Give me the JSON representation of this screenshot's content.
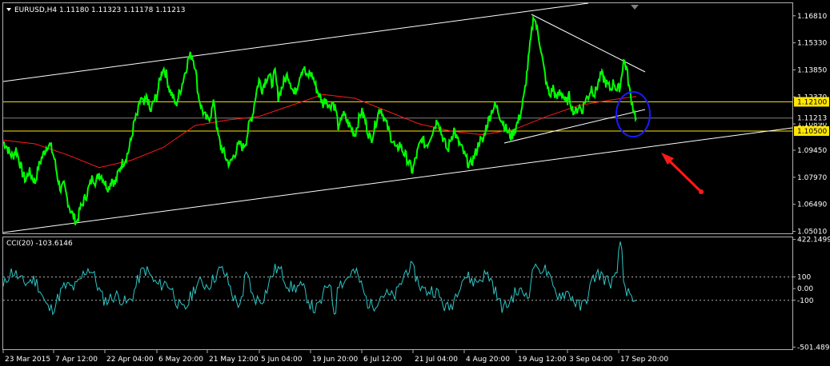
{
  "chart_data": [
    {
      "type": "line",
      "header": "EURUSD,H4  1.11180 1.11323 1.11178 1.11213",
      "y_ticks": [
        1.1681,
        1.1533,
        1.1385,
        1.1237,
        1.1089,
        1.0945,
        1.0797,
        1.0649,
        1.0501
      ],
      "y_tick_labels": [
        "1.16810",
        "1.15330",
        "1.13850",
        "1.12370",
        "1.10890",
        "1.09450",
        "1.07970",
        "1.06490",
        "1.05010"
      ],
      "ylim": [
        1.049,
        1.175
      ],
      "x_tick_labels": [
        "23 Mar 2015",
        "7 Apr 12:00",
        "22 Apr 04:00",
        "6 May 20:00",
        "21 May 12:00",
        "5 Jun 04:00",
        "19 Jun 20:00",
        "6 Jul 12:00",
        "21 Jul 04:00",
        "4 Aug 20:00",
        "19 Aug 12:00",
        "3 Sep 04:00",
        "17 Sep 20:00"
      ],
      "price_close_series": [
        [
          0,
          1.099
        ],
        [
          4,
          1.097
        ],
        [
          8,
          1.093
        ],
        [
          12,
          1.091
        ],
        [
          16,
          1.095
        ],
        [
          20,
          1.089
        ],
        [
          24,
          1.082
        ],
        [
          28,
          1.078
        ],
        [
          32,
          1.083
        ],
        [
          36,
          1.08
        ],
        [
          40,
          1.077
        ],
        [
          44,
          1.085
        ],
        [
          48,
          1.09
        ],
        [
          52,
          1.094
        ],
        [
          56,
          1.098
        ],
        [
          60,
          1.096
        ],
        [
          64,
          1.09
        ],
        [
          68,
          1.08
        ],
        [
          72,
          1.073
        ],
        [
          76,
          1.075
        ],
        [
          80,
          1.068
        ],
        [
          84,
          1.062
        ],
        [
          88,
          1.058
        ],
        [
          92,
          1.055
        ],
        [
          96,
          1.062
        ],
        [
          100,
          1.066
        ],
        [
          104,
          1.07
        ],
        [
          108,
          1.075
        ],
        [
          112,
          1.08
        ],
        [
          116,
          1.077
        ],
        [
          120,
          1.082
        ],
        [
          124,
          1.08
        ],
        [
          128,
          1.076
        ],
        [
          132,
          1.074
        ],
        [
          136,
          1.079
        ],
        [
          140,
          1.076
        ],
        [
          144,
          1.082
        ],
        [
          148,
          1.087
        ],
        [
          152,
          1.089
        ],
        [
          156,
          1.093
        ],
        [
          160,
          1.1
        ],
        [
          164,
          1.11
        ],
        [
          168,
          1.114
        ],
        [
          172,
          1.123
        ],
        [
          176,
          1.119
        ],
        [
          180,
          1.124
        ],
        [
          184,
          1.115
        ],
        [
          188,
          1.121
        ],
        [
          192,
          1.124
        ],
        [
          196,
          1.133
        ],
        [
          200,
          1.14
        ],
        [
          204,
          1.136
        ],
        [
          208,
          1.128
        ],
        [
          212,
          1.124
        ],
        [
          216,
          1.119
        ],
        [
          220,
          1.125
        ],
        [
          224,
          1.131
        ],
        [
          228,
          1.138
        ],
        [
          232,
          1.145
        ],
        [
          236,
          1.147
        ],
        [
          240,
          1.141
        ],
        [
          244,
          1.125
        ],
        [
          248,
          1.118
        ],
        [
          252,
          1.113
        ],
        [
          256,
          1.111
        ],
        [
          260,
          1.115
        ],
        [
          264,
          1.121
        ],
        [
          268,
          1.104
        ],
        [
          272,
          1.097
        ],
        [
          276,
          1.093
        ],
        [
          280,
          1.089
        ],
        [
          284,
          1.087
        ],
        [
          288,
          1.091
        ],
        [
          292,
          1.095
        ],
        [
          296,
          1.098
        ],
        [
          300,
          1.096
        ],
        [
          304,
          1.1
        ],
        [
          308,
          1.109
        ],
        [
          312,
          1.114
        ],
        [
          316,
          1.125
        ],
        [
          320,
          1.133
        ],
        [
          324,
          1.128
        ],
        [
          328,
          1.133
        ],
        [
          332,
          1.136
        ],
        [
          336,
          1.131
        ],
        [
          340,
          1.137
        ],
        [
          344,
          1.124
        ],
        [
          348,
          1.128
        ],
        [
          352,
          1.133
        ],
        [
          356,
          1.136
        ],
        [
          360,
          1.131
        ],
        [
          364,
          1.125
        ],
        [
          368,
          1.13
        ],
        [
          372,
          1.137
        ],
        [
          376,
          1.14
        ],
        [
          380,
          1.134
        ],
        [
          384,
          1.137
        ],
        [
          388,
          1.134
        ],
        [
          392,
          1.128
        ],
        [
          396,
          1.124
        ],
        [
          400,
          1.12
        ],
        [
          404,
          1.123
        ],
        [
          408,
          1.118
        ],
        [
          412,
          1.121
        ],
        [
          416,
          1.117
        ],
        [
          420,
          1.105
        ],
        [
          424,
          1.115
        ],
        [
          428,
          1.112
        ],
        [
          432,
          1.109
        ],
        [
          436,
          1.106
        ],
        [
          440,
          1.103
        ],
        [
          444,
          1.11
        ],
        [
          448,
          1.116
        ],
        [
          452,
          1.112
        ],
        [
          456,
          1.105
        ],
        [
          460,
          1.1
        ],
        [
          464,
          1.106
        ],
        [
          468,
          1.113
        ],
        [
          472,
          1.118
        ],
        [
          476,
          1.113
        ],
        [
          480,
          1.108
        ],
        [
          484,
          1.103
        ],
        [
          488,
          1.099
        ],
        [
          492,
          1.094
        ],
        [
          496,
          1.098
        ],
        [
          500,
          1.094
        ],
        [
          504,
          1.091
        ],
        [
          508,
          1.087
        ],
        [
          512,
          1.083
        ],
        [
          516,
          1.09
        ],
        [
          520,
          1.096
        ],
        [
          524,
          1.101
        ],
        [
          528,
          1.097
        ],
        [
          532,
          1.099
        ],
        [
          536,
          1.104
        ],
        [
          540,
          1.108
        ],
        [
          544,
          1.112
        ],
        [
          548,
          1.104
        ],
        [
          552,
          1.099
        ],
        [
          556,
          1.094
        ],
        [
          560,
          1.101
        ],
        [
          564,
          1.106
        ],
        [
          568,
          1.1
        ],
        [
          572,
          1.097
        ],
        [
          576,
          1.093
        ],
        [
          580,
          1.089
        ],
        [
          584,
          1.086
        ],
        [
          588,
          1.09
        ],
        [
          592,
          1.094
        ],
        [
          596,
          1.1
        ],
        [
          600,
          1.099
        ],
        [
          604,
          1.107
        ],
        [
          608,
          1.112
        ],
        [
          612,
          1.117
        ],
        [
          616,
          1.119
        ],
        [
          620,
          1.115
        ],
        [
          624,
          1.111
        ],
        [
          628,
          1.107
        ],
        [
          632,
          1.104
        ],
        [
          636,
          1.102
        ],
        [
          640,
          1.106
        ],
        [
          644,
          1.11
        ],
        [
          648,
          1.116
        ],
        [
          652,
          1.125
        ],
        [
          656,
          1.14
        ],
        [
          660,
          1.155
        ],
        [
          664,
          1.169
        ],
        [
          668,
          1.16
        ],
        [
          672,
          1.152
        ],
        [
          676,
          1.14
        ],
        [
          680,
          1.13
        ],
        [
          684,
          1.124
        ],
        [
          688,
          1.129
        ],
        [
          692,
          1.122
        ],
        [
          696,
          1.127
        ],
        [
          700,
          1.125
        ],
        [
          704,
          1.12
        ],
        [
          708,
          1.124
        ],
        [
          712,
          1.117
        ],
        [
          716,
          1.115
        ],
        [
          720,
          1.119
        ],
        [
          724,
          1.116
        ],
        [
          728,
          1.122
        ],
        [
          732,
          1.124
        ],
        [
          736,
          1.129
        ],
        [
          740,
          1.125
        ],
        [
          744,
          1.131
        ],
        [
          748,
          1.136
        ],
        [
          752,
          1.133
        ],
        [
          756,
          1.13
        ],
        [
          760,
          1.128
        ],
        [
          764,
          1.132
        ],
        [
          768,
          1.127
        ],
        [
          772,
          1.13
        ],
        [
          776,
          1.144
        ],
        [
          780,
          1.139
        ],
        [
          784,
          1.126
        ],
        [
          788,
          1.118
        ],
        [
          792,
          1.112
        ]
      ],
      "ma_series": [
        [
          0,
          1.1
        ],
        [
          40,
          1.098
        ],
        [
          80,
          1.092
        ],
        [
          120,
          1.085
        ],
        [
          160,
          1.089
        ],
        [
          200,
          1.096
        ],
        [
          240,
          1.108
        ],
        [
          280,
          1.111
        ],
        [
          320,
          1.113
        ],
        [
          360,
          1.119
        ],
        [
          400,
          1.125
        ],
        [
          440,
          1.123
        ],
        [
          480,
          1.116
        ],
        [
          520,
          1.109
        ],
        [
          560,
          1.105
        ],
        [
          600,
          1.103
        ],
        [
          640,
          1.106
        ],
        [
          680,
          1.113
        ],
        [
          720,
          1.119
        ],
        [
          760,
          1.122
        ],
        [
          792,
          1.124
        ]
      ],
      "cci_label": "CCI(20) -103.6146",
      "cci_ticks": [
        422.1499,
        100,
        0,
        -100,
        -501.489
      ],
      "cci_tick_labels": [
        "422.1499",
        "100",
        "0.00",
        "-100",
        "-501.489"
      ],
      "cci_ylim": [
        -520,
        440
      ],
      "horizontal_levels": [
        {
          "label": "1.12100",
          "value": 1.121,
          "color": "#ffe600"
        },
        {
          "label": "1.11213",
          "value": 1.11213,
          "color": "#808080"
        },
        {
          "label": "1.10500",
          "value": 1.105,
          "color": "#ffe600"
        }
      ]
    }
  ]
}
